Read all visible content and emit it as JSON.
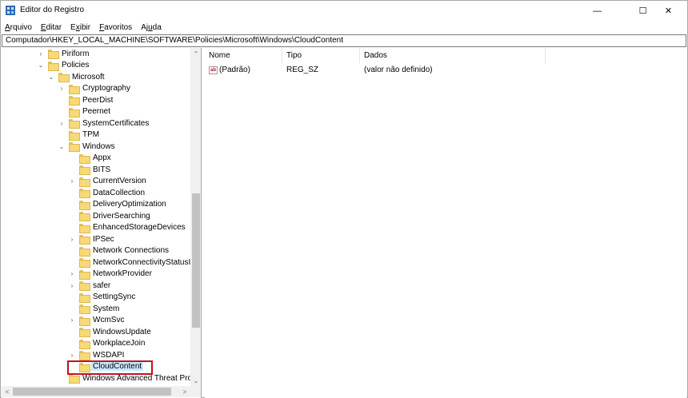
{
  "window": {
    "title": "Editor do Registro",
    "icon": "registry-editor-icon",
    "controls": {
      "minimize": "—",
      "maximize": "☐",
      "close": "✕"
    }
  },
  "menu": [
    {
      "accel": "A",
      "rest": "rquivo"
    },
    {
      "accel": "E",
      "rest": "ditar"
    },
    {
      "accel": "x",
      "prefix": "E",
      "rest": "ibir"
    },
    {
      "accel": "F",
      "rest": "avoritos"
    },
    {
      "accel": "u",
      "prefix": "Aj",
      "rest": "da"
    }
  ],
  "address": "Computador\\HKEY_LOCAL_MACHINE\\SOFTWARE\\Policies\\Microsoft\\Windows\\CloudContent",
  "tree": [
    {
      "label": "Piriform",
      "level": 0,
      "chevron": "›",
      "selected": false
    },
    {
      "label": "Policies",
      "level": 0,
      "chevron": "⌄",
      "selected": false
    },
    {
      "label": "Microsoft",
      "level": 1,
      "chevron": "⌄",
      "selected": false
    },
    {
      "label": "Cryptography",
      "level": 2,
      "chevron": "›",
      "selected": false
    },
    {
      "label": "PeerDist",
      "level": 2,
      "chevron": "",
      "selected": false
    },
    {
      "label": "Peernet",
      "level": 2,
      "chevron": "",
      "selected": false
    },
    {
      "label": "SystemCertificates",
      "level": 2,
      "chevron": "›",
      "selected": false
    },
    {
      "label": "TPM",
      "level": 2,
      "chevron": "",
      "selected": false
    },
    {
      "label": "Windows",
      "level": 2,
      "chevron": "⌄",
      "selected": false
    },
    {
      "label": "Appx",
      "level": 3,
      "chevron": "",
      "selected": false
    },
    {
      "label": "BITS",
      "level": 3,
      "chevron": "",
      "selected": false
    },
    {
      "label": "CurrentVersion",
      "level": 3,
      "chevron": "›",
      "selected": false
    },
    {
      "label": "DataCollection",
      "level": 3,
      "chevron": "",
      "selected": false
    },
    {
      "label": "DeliveryOptimization",
      "level": 3,
      "chevron": "",
      "selected": false
    },
    {
      "label": "DriverSearching",
      "level": 3,
      "chevron": "",
      "selected": false
    },
    {
      "label": "EnhancedStorageDevices",
      "level": 3,
      "chevron": "",
      "selected": false
    },
    {
      "label": "IPSec",
      "level": 3,
      "chevron": "›",
      "selected": false
    },
    {
      "label": "Network Connections",
      "level": 3,
      "chevron": "",
      "selected": false
    },
    {
      "label": "NetworkConnectivityStatusIn",
      "level": 3,
      "chevron": "",
      "selected": false
    },
    {
      "label": "NetworkProvider",
      "level": 3,
      "chevron": "›",
      "selected": false
    },
    {
      "label": "safer",
      "level": 3,
      "chevron": "›",
      "selected": false
    },
    {
      "label": "SettingSync",
      "level": 3,
      "chevron": "",
      "selected": false
    },
    {
      "label": "System",
      "level": 3,
      "chevron": "",
      "selected": false
    },
    {
      "label": "WcmSvc",
      "level": 3,
      "chevron": "›",
      "selected": false
    },
    {
      "label": "WindowsUpdate",
      "level": 3,
      "chevron": "",
      "selected": false
    },
    {
      "label": "WorkplaceJoin",
      "level": 3,
      "chevron": "",
      "selected": false
    },
    {
      "label": "WSDAPI",
      "level": 3,
      "chevron": "›",
      "selected": false
    },
    {
      "label": "CloudContent",
      "level": 3,
      "chevron": "",
      "selected": true
    },
    {
      "label": "Windows Advanced Threat Prote",
      "level": 2,
      "chevron": "",
      "selected": false
    }
  ],
  "values": {
    "headers": {
      "name": "Nome",
      "type": "Tipo",
      "data": "Dados"
    },
    "rows": [
      {
        "icon": "ab",
        "name": "(Padrão)",
        "type": "REG_SZ",
        "data": "(valor não definido)"
      }
    ]
  },
  "scroll": {
    "up": "⌃",
    "down": "⌄",
    "left": "<",
    "right": ">"
  },
  "accent": {
    "selection": "#cce8ff",
    "highlight_box": "#c1121f",
    "folder": "#f7d978"
  }
}
